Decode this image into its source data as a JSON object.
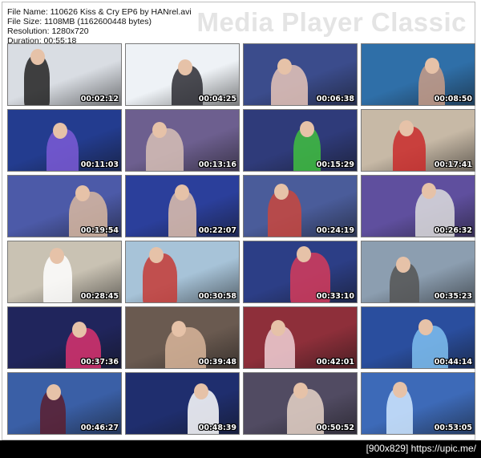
{
  "header": {
    "file_name": "File Name: 110626 Kiss & Cry EP6 by HANrel.avi",
    "file_size": "File Size: 1108MB (1162600448 bytes)",
    "resolution": "Resolution: 1280x720",
    "duration": "Duration: 00:55:18",
    "brand": "Media Player Classic"
  },
  "thumbnails": [
    {
      "timestamp": "00:02:12",
      "bg": "#d9dde3",
      "accent": "#222222"
    },
    {
      "timestamp": "00:04:25",
      "bg": "#eef2f6",
      "accent": "#2b2b33"
    },
    {
      "timestamp": "00:06:38",
      "bg": "#3b4c8c",
      "accent": "#e8c6b8"
    },
    {
      "timestamp": "00:08:50",
      "bg": "#2f6fa8",
      "accent": "#c99c86"
    },
    {
      "timestamp": "00:11:03",
      "bg": "#233c8f",
      "accent": "#7b5bd6"
    },
    {
      "timestamp": "00:13:16",
      "bg": "#6d5f8f",
      "accent": "#d7c0b6"
    },
    {
      "timestamp": "00:15:29",
      "bg": "#2f3b7a",
      "accent": "#3fbf3f"
    },
    {
      "timestamp": "00:17:41",
      "bg": "#c7b9a6",
      "accent": "#c92a2a"
    },
    {
      "timestamp": "00:19:54",
      "bg": "#4c5aa8",
      "accent": "#d9b8a0"
    },
    {
      "timestamp": "00:22:07",
      "bg": "#2b3f9b",
      "accent": "#e1c1ad"
    },
    {
      "timestamp": "00:24:19",
      "bg": "#4a5c9a",
      "accent": "#c9463d"
    },
    {
      "timestamp": "00:26:32",
      "bg": "#5f4f9e",
      "accent": "#dddddd"
    },
    {
      "timestamp": "00:28:45",
      "bg": "#c9c2b3",
      "accent": "#ffffff"
    },
    {
      "timestamp": "00:30:58",
      "bg": "#a7c3d8",
      "accent": "#c63b36"
    },
    {
      "timestamp": "00:33:10",
      "bg": "#2c3e86",
      "accent": "#d63b5a"
    },
    {
      "timestamp": "00:35:23",
      "bg": "#8c9eb0",
      "accent": "#555555"
    },
    {
      "timestamp": "00:37:36",
      "bg": "#20255c",
      "accent": "#d9326f"
    },
    {
      "timestamp": "00:39:48",
      "bg": "#6a5a50",
      "accent": "#d8b59a"
    },
    {
      "timestamp": "00:42:01",
      "bg": "#8e2f3a",
      "accent": "#f0d0d6"
    },
    {
      "timestamp": "00:44:14",
      "bg": "#2a4e9e",
      "accent": "#7fc0f0"
    },
    {
      "timestamp": "00:46:27",
      "bg": "#3a5fa6",
      "accent": "#5c1f2f"
    },
    {
      "timestamp": "00:48:39",
      "bg": "#1f2e6e",
      "accent": "#ffffff"
    },
    {
      "timestamp": "00:50:52",
      "bg": "#514b62",
      "accent": "#e6d4c8"
    },
    {
      "timestamp": "00:53:05",
      "bg": "#3d6ab8",
      "accent": "#d0e8ff"
    }
  ],
  "footer": {
    "text": "[900x829] https://upic.me/"
  }
}
